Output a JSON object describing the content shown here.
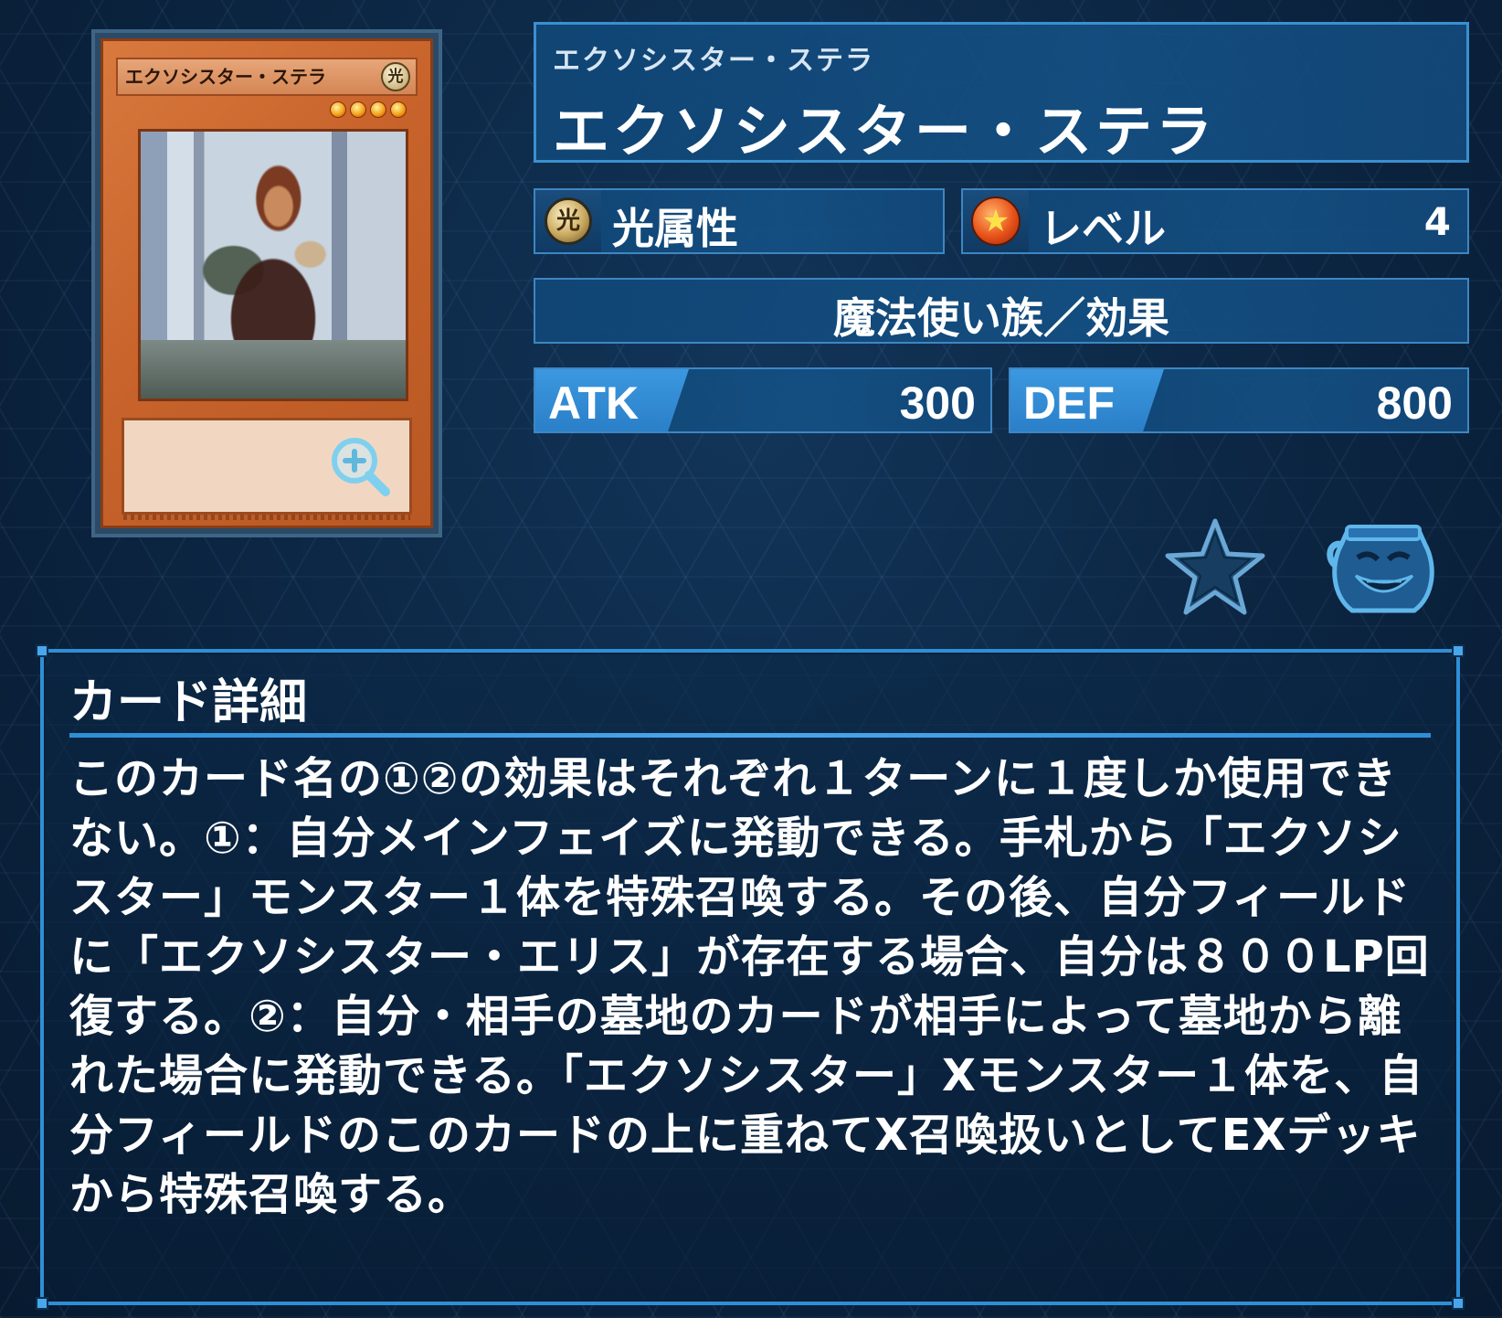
{
  "card": {
    "name_on_card": "エクソシスター・ステラ",
    "attribute_glyph": "光",
    "level_stars": 4,
    "zoom_icon": "zoom-in-icon"
  },
  "header": {
    "ruby": "エクソシスター・ステラ",
    "name": "エクソシスター・ステラ"
  },
  "attribute": {
    "icon_glyph": "光",
    "label": "光属性"
  },
  "level": {
    "label": "レベル",
    "value": "4",
    "icon": "level-star-icon"
  },
  "type_line": "魔法使い族／効果",
  "stats": {
    "atk_label": "ATK",
    "atk_value": "300",
    "def_label": "DEF",
    "def_value": "800"
  },
  "actions": {
    "favorite_icon": "favorite-star-icon",
    "pot_icon": "pot-of-greed-icon"
  },
  "details": {
    "title": "カード詳細",
    "text": "このカード名の①②の効果はそれぞれ１ターンに１度しか使用できない。①：自分メインフェイズに発動できる。手札から「エクソシスター」モンスター１体を特殊召喚する。その後、自分フィールドに「エクソシスター・エリス」が存在する場合、自分は８００LP回復する。②：自分・相手の墓地のカードが相手によって墓地から離れた場合に発動できる。「エクソシスター」Xモンスター１体を、自分フィールドのこのカードの上に重ねてX召喚扱いとしてEXデッキから特殊召喚する。"
  },
  "colors": {
    "background": "#0b2440",
    "panel": "#14528a",
    "panel_border": "#3e86c2",
    "stat_tab": "#3b98e0",
    "card_frame": "#c7632b"
  }
}
